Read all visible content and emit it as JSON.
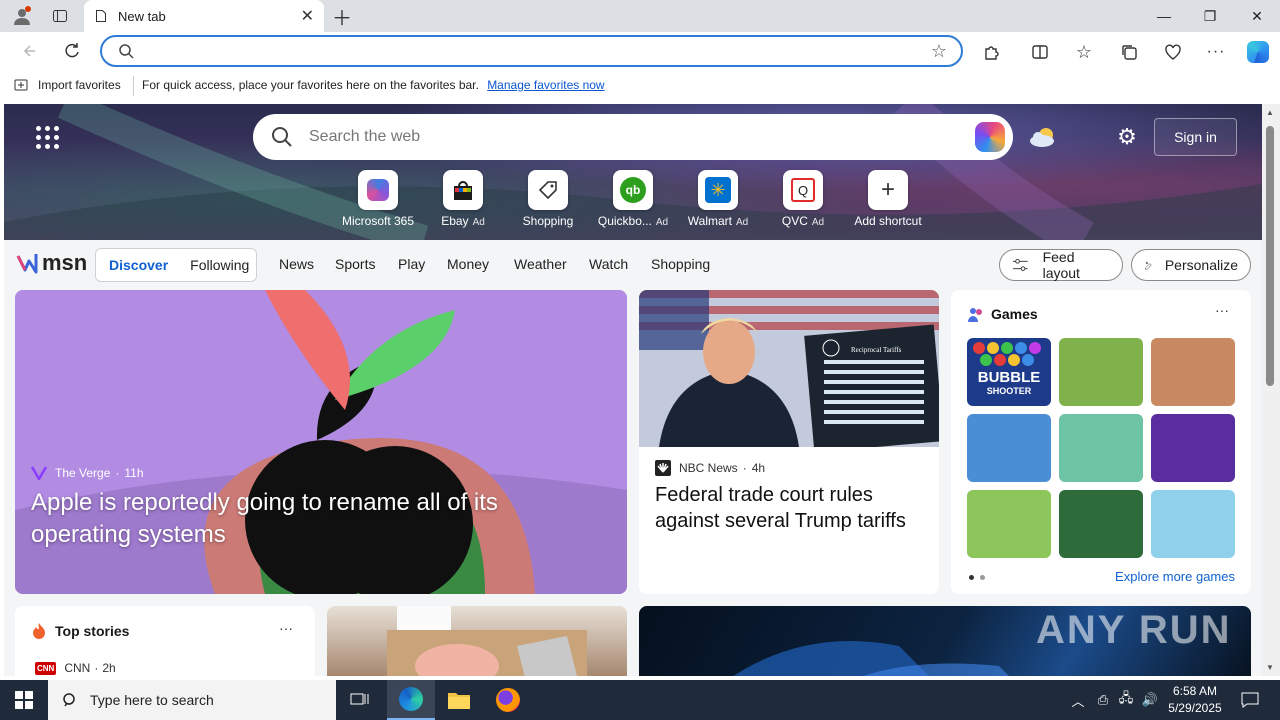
{
  "browser": {
    "tab_title": "New tab",
    "address_value": "",
    "favorites_bar": {
      "import_label": "Import favorites",
      "hint": "For quick access, place your favorites here on the favorites bar.",
      "manage_link": "Manage favorites now"
    }
  },
  "hero": {
    "search_placeholder": "Search the web",
    "sign_in": "Sign in",
    "shortcuts": [
      {
        "label": "Microsoft 365",
        "ad": "",
        "icon": "microsoft-365-icon"
      },
      {
        "label": "Ebay",
        "ad": "Ad",
        "icon": "ebay-icon"
      },
      {
        "label": "Shopping",
        "ad": "",
        "icon": "shopping-tag-icon"
      },
      {
        "label": "Quickbo...",
        "ad": "Ad",
        "icon": "quickbooks-icon"
      },
      {
        "label": "Walmart",
        "ad": "Ad",
        "icon": "walmart-icon"
      },
      {
        "label": "QVC",
        "ad": "Ad",
        "icon": "qvc-icon"
      },
      {
        "label": "Add shortcut",
        "ad": "",
        "icon": "plus-icon"
      }
    ]
  },
  "msn_nav": {
    "logo": "msn",
    "discover": "Discover",
    "following": "Following",
    "links": [
      "News",
      "Sports",
      "Play",
      "Money",
      "Weather",
      "Watch",
      "Shopping"
    ],
    "feed_layout": "Feed layout",
    "personalize": "Personalize"
  },
  "hero_story": {
    "source": "The Verge",
    "age": "11h",
    "title": "Apple is reportedly going to rename all of its operating systems"
  },
  "news_story": {
    "source": "NBC News",
    "age": "4h",
    "title": "Federal trade court rules against several Trump tariffs",
    "sign_heading": "Reciprocal Tariffs"
  },
  "games": {
    "title": "Games",
    "explore": "Explore more games",
    "bubble_title": "BUBBLE",
    "bubble_sub": "SHOOTER",
    "tiles": [
      {
        "color": "#1d3b8a"
      },
      {
        "color": "#7fb24a"
      },
      {
        "color": "#c98a63"
      },
      {
        "color": "#4a8fd6"
      },
      {
        "color": "#6cc4a4"
      },
      {
        "color": "#5a2d9e"
      },
      {
        "color": "#8dc75c"
      },
      {
        "color": "#2d6b3a"
      },
      {
        "color": "#8fd0ea"
      }
    ]
  },
  "top_stories": {
    "title": "Top stories",
    "source": "CNN",
    "age": "2h"
  },
  "taskbar": {
    "search_placeholder": "Type here to search",
    "time": "6:58 AM",
    "date": "5/29/2025"
  },
  "watermark": "ANY RUN"
}
